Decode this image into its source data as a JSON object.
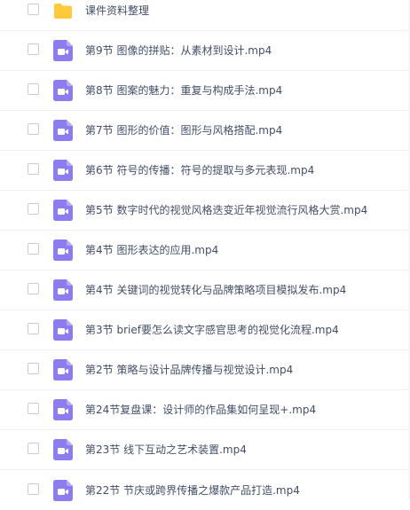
{
  "files": [
    {
      "name": "课件资料整理",
      "type": "folder",
      "icon": "folder-icon"
    },
    {
      "name": "第9节 图像的拼贴：从素材到设计.mp4",
      "type": "video",
      "icon": "video-file-icon"
    },
    {
      "name": "第8节 图案的魅力：重复与构成手法.mp4",
      "type": "video",
      "icon": "video-file-icon"
    },
    {
      "name": "第7节 图形的价值：图形与风格搭配.mp4",
      "type": "video",
      "icon": "video-file-icon"
    },
    {
      "name": "第6节 符号的传播：符号的提取与多元表现.mp4",
      "type": "video",
      "icon": "video-file-icon"
    },
    {
      "name": "第5节 数字时代的视觉风格迭变近年视觉流行风格大赏.mp4",
      "type": "video",
      "icon": "video-file-icon"
    },
    {
      "name": "第4节 图形表达的应用.mp4",
      "type": "video",
      "icon": "video-file-icon"
    },
    {
      "name": "第4节 关键词的视觉转化与品牌策略项目模拟发布.mp4",
      "type": "video",
      "icon": "video-file-icon"
    },
    {
      "name": "第3节 brief要怎么读文字感官思考的视觉化流程.mp4",
      "type": "video",
      "icon": "video-file-icon"
    },
    {
      "name": "第2节 策略与设计品牌传播与视觉设计.mp4",
      "type": "video",
      "icon": "video-file-icon"
    },
    {
      "name": "第24节复盘课：设计师的作品集如何呈现+.mp4",
      "type": "video",
      "icon": "video-file-icon"
    },
    {
      "name": "第23节 线下互动之艺术装置.mp4",
      "type": "video",
      "icon": "video-file-icon"
    },
    {
      "name": "第22节 节庆或跨界传播之爆款产品打造.mp4",
      "type": "video",
      "icon": "video-file-icon"
    }
  ],
  "colors": {
    "folder": "#ffc93c",
    "video": "#8b7cf0",
    "text": "#424e67"
  }
}
